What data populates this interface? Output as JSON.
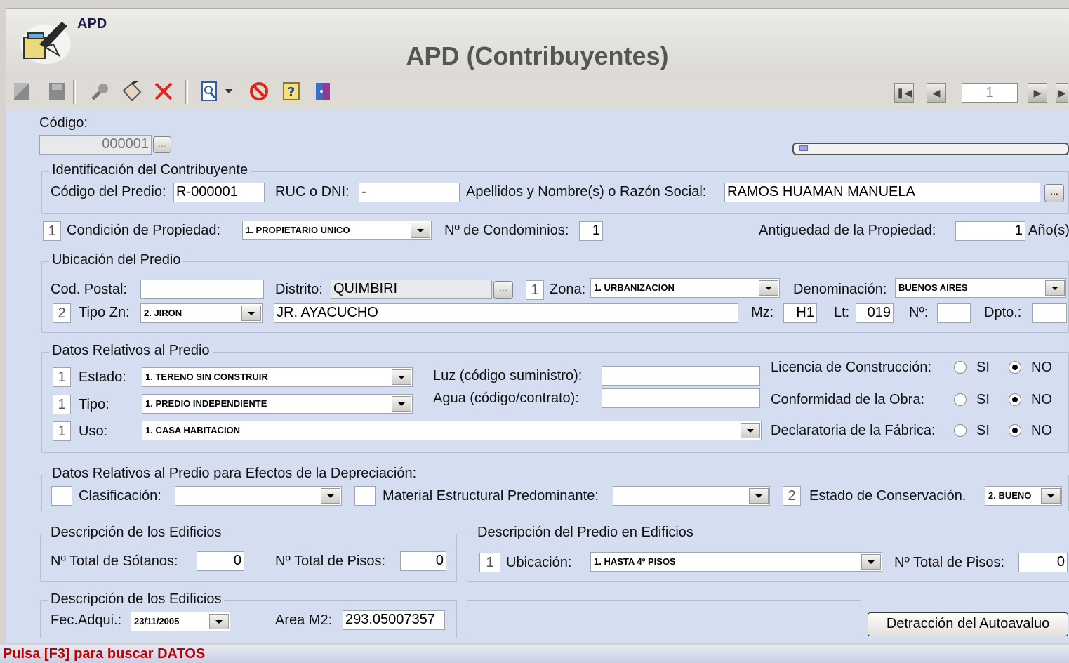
{
  "window": {
    "app_name": "APD",
    "title": "APD (Contribuyentes)"
  },
  "toolbar": {
    "record_number": "1"
  },
  "codigo": {
    "label": "Código:",
    "value": "000001",
    "browse": "..."
  },
  "identificacion": {
    "title": "Identificación del Contribuyente",
    "cod_predio_label": "Código del Predio:",
    "cod_predio": "R-000001",
    "ruc_label": "RUC o DNI:",
    "ruc": "-",
    "nombre_label": "Apellidos y Nombre(s) o Razón Social:",
    "nombre": "RAMOS HUAMAN MANUELA",
    "browse": "..."
  },
  "propiedad": {
    "cond_code": "1",
    "cond_label": "Condición de Propiedad:",
    "cond_value": "1. PROPIETARIO UNICO",
    "condominios_label": "Nº de Condominios:",
    "condominios": "1",
    "antiguedad_label": "Antiguedad de la Propiedad:",
    "antiguedad": "1",
    "anos_label": "Año(s)"
  },
  "ubicacion": {
    "title": "Ubicación del Predio",
    "postal_label": "Cod. Postal:",
    "postal": "",
    "distrito_label": "Distrito:",
    "distrito": "QUIMBIRI",
    "browse": "...",
    "zona_code": "1",
    "zona_label": "Zona:",
    "zona_value": "1. URBANIZACION",
    "denom_label": "Denominación:",
    "denom_value": "BUENOS AIRES",
    "tipozn_code": "2",
    "tipozn_label": "Tipo Zn:",
    "tipozn_value": "2. JIRON",
    "calle": "JR. AYACUCHO",
    "mz_label": "Mz:",
    "mz": "H1",
    "lt_label": "Lt:",
    "lt": "019",
    "num_label": "Nº:",
    "num": "",
    "dpto_label": "Dpto.:",
    "dpto": ""
  },
  "datos_predio": {
    "title": "Datos Relativos al Predio",
    "estado_code": "1",
    "estado_label": "Estado:",
    "estado_value": "1. TERENO SIN CONSTRUIR",
    "tipo_code": "1",
    "tipo_label": "Tipo:",
    "tipo_value": "1. PREDIO INDEPENDIENTE",
    "uso_code": "1",
    "uso_label": "Uso:",
    "uso_value": "1. CASA HABITACION",
    "luz_label": "Luz (código suministro):",
    "luz": "",
    "agua_label": "Agua (código/contrato):",
    "agua": "",
    "licencia_label": "Licencia de Construcción:",
    "conformidad_label": "Conformidad de la Obra:",
    "declaratoria_label": "Declaratoria de la Fábrica:",
    "si": "SI",
    "no": "NO"
  },
  "depreciacion": {
    "title": "Datos Relativos al Predio para Efectos de la Depreciación:",
    "clasif_code": "",
    "clasif_label": "Clasificación:",
    "clasif_value": "",
    "material_code": "",
    "material_label": "Material Estructural Predominante:",
    "material_value": "",
    "conserv_code": "2",
    "conserv_label": "Estado de Conservación.",
    "conserv_value": "2. BUENO"
  },
  "edificios": {
    "title": "Descripción de los Edificios",
    "sotanos_label": "Nº Total de Sótanos:",
    "sotanos": "0",
    "pisos_label": "Nº Total de Pisos:",
    "pisos": "0"
  },
  "predio_edificios": {
    "title": "Descripción del Predio en Edificios",
    "ubic_code": "1",
    "ubic_label": "Ubicación:",
    "ubic_value": "1. HASTA 4º PISOS",
    "pisos_label": "Nº Total de Pisos:",
    "pisos": "0"
  },
  "edificios2": {
    "title": "Descripción de los Edificios",
    "fec_label": "Fec.Adqui.:",
    "fec": "23/11/2005",
    "area_label": "Area M2:",
    "area": "293.05007357"
  },
  "detraccion_button": "Detracción del Autoavaluo",
  "status": "Pulsa [F3] para buscar DATOS"
}
